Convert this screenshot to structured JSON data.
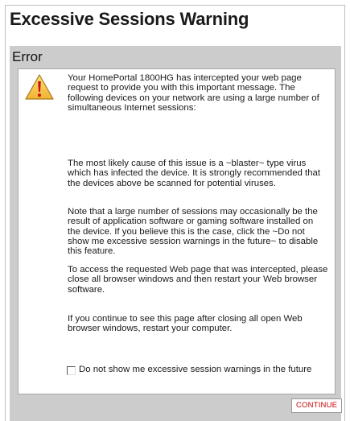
{
  "page": {
    "title": "Excessive Sessions Warning"
  },
  "panel": {
    "heading": "Error"
  },
  "message": {
    "icon": "warning-triangle-icon",
    "paragraphs": [
      "Your HomePortal 1800HG has intercepted your web page request to provide you with this important message. The following devices on your network are using a large number of simultaneous Internet sessions:",
      "The most likely cause of this issue is a ~blaster~ type virus which has infected the device. It is strongly recommended that the devices above be scanned for potential viruses.",
      "Note that a large number of sessions may occasionally be the result of application software or gaming software installed on the device. If you believe this is the case, click the ~Do not show me excessive session warnings in the future~ to disable this feature.",
      "To access the requested Web page that was intercepted, please close all browser windows and then restart your Web browser software.",
      "If you continue to see this page after closing all open Web browser windows, restart your computer."
    ]
  },
  "optout": {
    "label": "Do not show me excessive session warnings in the future",
    "checked": false
  },
  "actions": {
    "continue_label": "CONTINUE"
  },
  "colors": {
    "panel_bg": "#cccccc",
    "continue_text": "#cc0000",
    "icon_fill": "#f7c948",
    "icon_mark": "#cc1111"
  }
}
